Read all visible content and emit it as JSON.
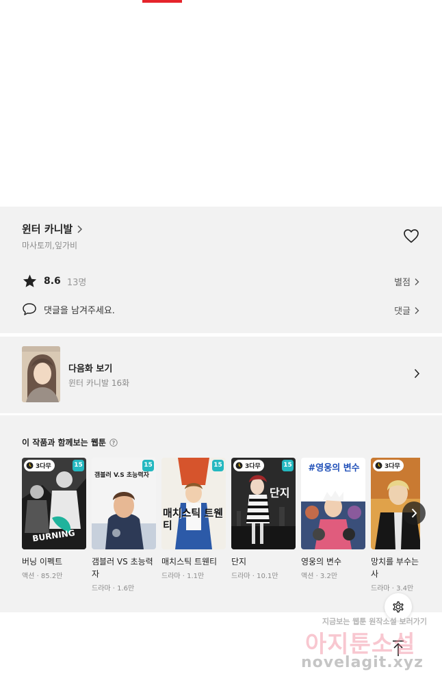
{
  "work": {
    "title": "윈터 카니발",
    "authors": "마사토끼,잎가비",
    "rating": "8.6",
    "rating_count": "13명",
    "rate_label": "별점",
    "comment_placeholder": "댓글을 남겨주세요.",
    "comment_label": "댓글"
  },
  "next_episode": {
    "label": "다음화 보기",
    "subtitle": "윈터 카니발 16화"
  },
  "recommendations": {
    "title": "이 작품과 함께보는 웹툰",
    "items": [
      {
        "title": "버닝 이펙트",
        "meta": "액션 · 85.2만",
        "badge_wait": "3다무",
        "badge_age": "15",
        "cover_text": ""
      },
      {
        "title": "갬블러 VS 초능력자",
        "meta": "드라마 · 1.6만",
        "badge_wait": "",
        "badge_age": "15",
        "cover_text": "갬블러 V.S 초능력자"
      },
      {
        "title": "매치스틱 트웬티",
        "meta": "드라마 · 1.1만",
        "badge_wait": "",
        "badge_age": "15",
        "cover_text": "매치스틱 트웬티"
      },
      {
        "title": "단지",
        "meta": "드라마 · 10.1만",
        "badge_wait": "3다무",
        "badge_age": "15",
        "cover_text": "단지"
      },
      {
        "title": "영웅의 변수",
        "meta": "액션 · 3.2만",
        "badge_wait": "",
        "badge_age": "",
        "cover_text": "#영웅의 변수"
      },
      {
        "title": "망치를 부수는 호사",
        "meta": "드라마 · 3.4만",
        "badge_wait": "3다무",
        "badge_age": "",
        "cover_text": ""
      }
    ]
  },
  "watermark": {
    "line1": "지금보는 웹툰 원작소설 보러가기",
    "line2": "아지툰소설",
    "line3": "novelagit.xyz"
  },
  "colors": {
    "accent_red": "#e5242b",
    "age_badge": "#24b8c0",
    "band_gray": "#f2f2f2"
  }
}
